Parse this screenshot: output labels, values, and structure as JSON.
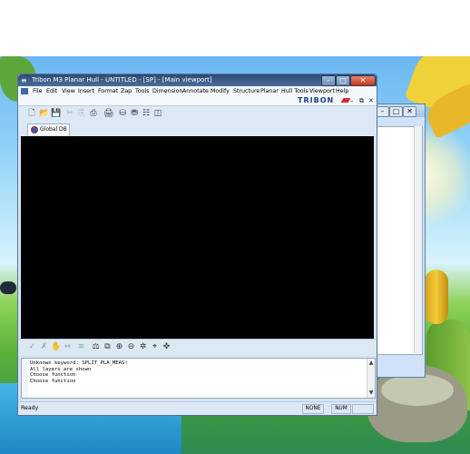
{
  "window": {
    "title": "Tribon M3 Planar Hull - UNTITLED - [SP] - [Main viewport]",
    "icon": "tribon-app-icon",
    "controls": {
      "minimize": "–",
      "maximize": "□",
      "close": "✕"
    }
  },
  "menu": [
    "File",
    "Edit",
    "View",
    "Insert",
    "Format",
    "Zap",
    "Tools",
    "Dimension",
    "Annotate",
    "Modify",
    "Structure",
    "Planar",
    "Hull Tools",
    "Viewport",
    "Help"
  ],
  "brand": {
    "logo_text": "TRIBON",
    "mdi_controls": [
      "–",
      "⧉",
      "✕"
    ]
  },
  "toolbar": {
    "icons": [
      "new-file-icon",
      "open-folder-icon",
      "save-icon",
      "cut-icon",
      "copy-icon",
      "paste-icon",
      "print-icon",
      "database-icon",
      "lock-icon",
      "layer-icon",
      "panel-icon"
    ],
    "glyphs": [
      "🗋",
      "📂",
      "💾",
      "✂",
      "⎘",
      "⎙",
      "🖨",
      "⛁",
      "⛃",
      "☷",
      "◫"
    ]
  },
  "db_tab": {
    "label": "Global DB"
  },
  "bottom_toolbar": {
    "icons": [
      "check-icon",
      "cross-icon",
      "hand-icon",
      "arrow-icon",
      "list-icon",
      "layer-icon",
      "rectangle-zoom-icon",
      "zoom-in-icon",
      "zoom-out-icon",
      "pan-icon",
      "zoom-fit-icon",
      "move-icon"
    ],
    "glyphs": [
      "✓",
      "✗",
      "✋",
      "⇔",
      "≡",
      "⚖",
      "⧉",
      "⊕",
      "⊖",
      "✲",
      "⌖",
      "✜"
    ]
  },
  "console": {
    "lines": [
      "Unknown keyword: SPLIT_PLA_MEAS!",
      "All layers are shown",
      "Choose function",
      "Choose function"
    ]
  },
  "status": {
    "text": "Ready",
    "panes": [
      "NONE",
      "NUM",
      ""
    ]
  },
  "colors": {
    "titlebar": "#2e4a73",
    "viewport": "#000000",
    "frame": "#d4e4f7",
    "brand": "#1d3e8a",
    "close": "#c2381c"
  }
}
